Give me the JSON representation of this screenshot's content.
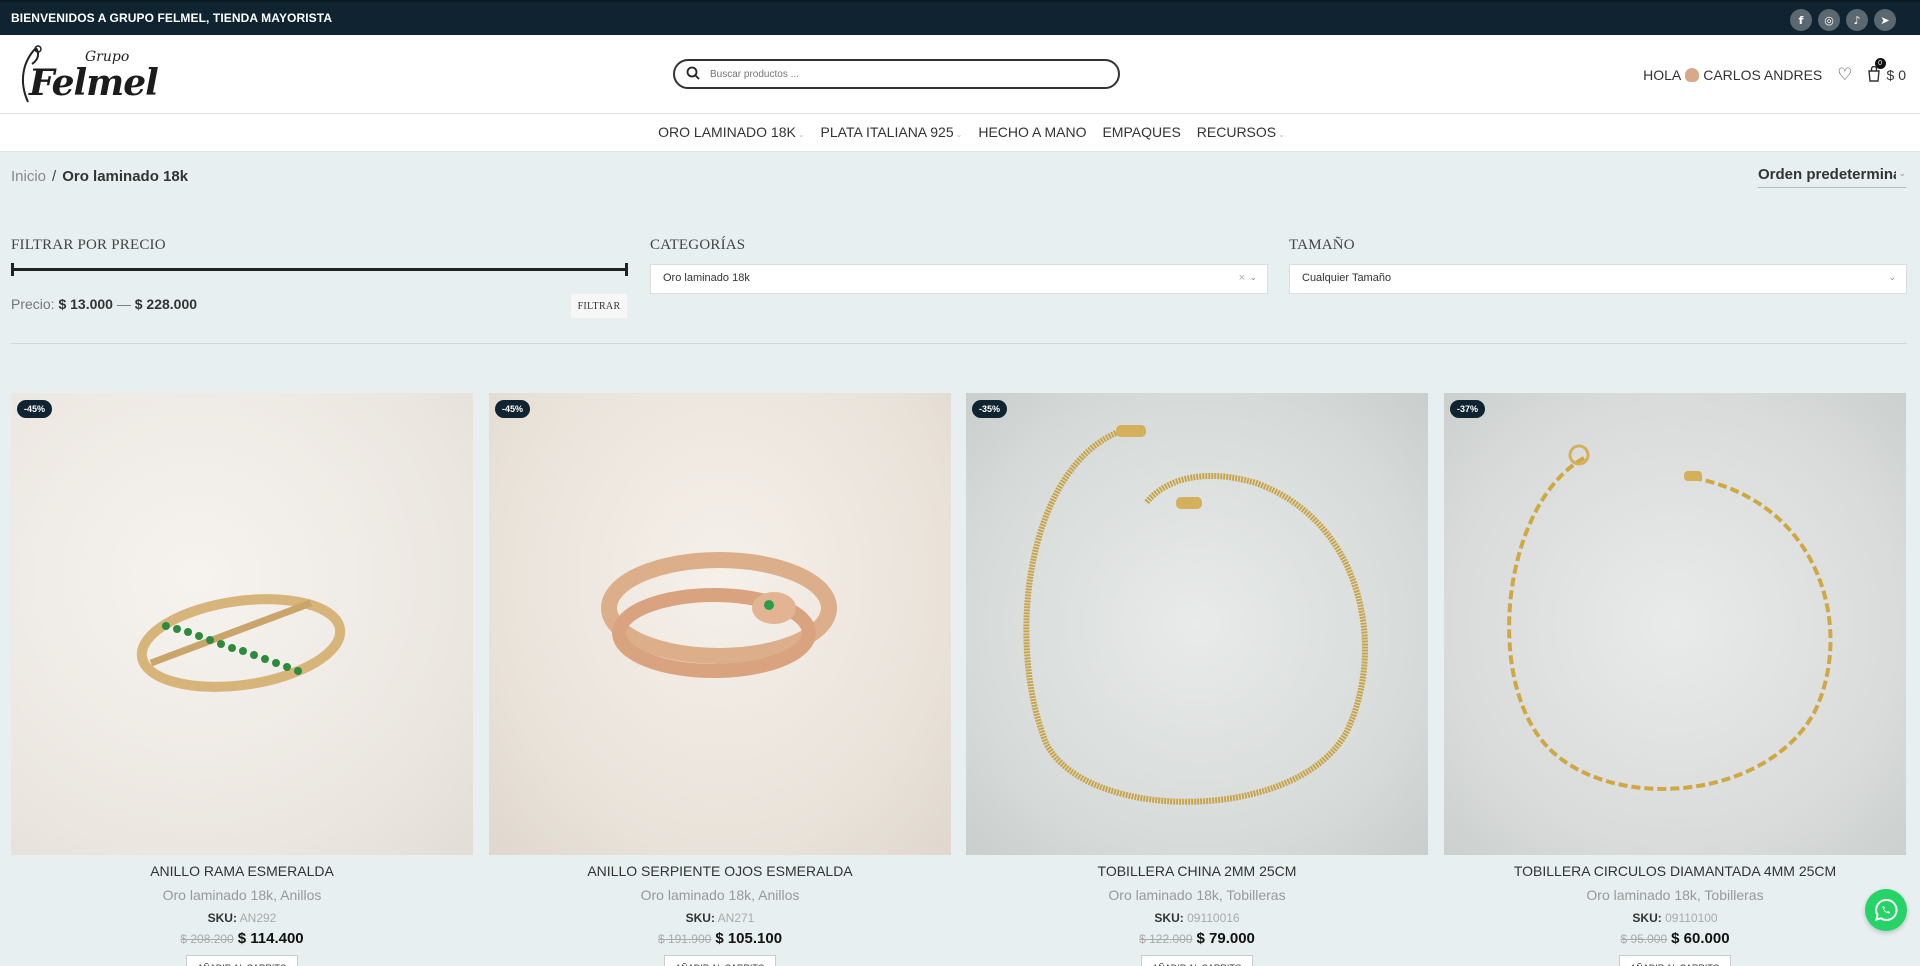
{
  "topbar": {
    "message": "BIENVENIDOS A GRUPO FELMEL, TIENDA MAYORISTA",
    "social": [
      {
        "icon": "facebook-icon",
        "glyph": "f"
      },
      {
        "icon": "instagram-icon",
        "glyph": "◎"
      },
      {
        "icon": "tiktok-icon",
        "glyph": "♪"
      },
      {
        "icon": "telegram-icon",
        "glyph": "➤"
      }
    ]
  },
  "header": {
    "logo": {
      "small": "Grupo",
      "big": "Felmel"
    },
    "search_placeholder": "Buscar productos ...",
    "greeting": "HOLA",
    "user_name": "CARLOS ANDRES",
    "cart_count": "0",
    "cart_total": "$ 0"
  },
  "nav": [
    {
      "label": "ORO LAMINADO 18K",
      "has_dropdown": true
    },
    {
      "label": "PLATA ITALIANA 925",
      "has_dropdown": true
    },
    {
      "label": "HECHO A MANO",
      "has_dropdown": false
    },
    {
      "label": "EMPAQUES",
      "has_dropdown": false
    },
    {
      "label": "RECURSOS",
      "has_dropdown": true
    }
  ],
  "breadcrumb": {
    "home": "Inicio",
    "separator": "/",
    "current": "Oro laminado 18k"
  },
  "ordering": {
    "selected": "Orden predeterminado"
  },
  "filters": {
    "price": {
      "title": "FILTRAR POR PRECIO",
      "label": "Precio:",
      "min": "$ 13.000",
      "dash": "—",
      "max": "$ 228.000",
      "button": "FILTRAR"
    },
    "categories": {
      "title": "CATEGORÍAS",
      "selected": "Oro laminado 18k",
      "clear": "×"
    },
    "size": {
      "title": "TAMAÑO",
      "selected": "Cualquier Tamaño"
    }
  },
  "products": [
    {
      "badge": "-45%",
      "title": "ANILLO RAMA ESMERALDA",
      "categories": "Oro laminado 18k, Anillos",
      "sku_label": "SKU:",
      "sku": "AN292",
      "old_price": "$ 208.200",
      "price": "$ 114.400",
      "button": "AÑADIR AL CARRITO",
      "image": "ring-branch-emerald"
    },
    {
      "badge": "-45%",
      "title": "ANILLO SERPIENTE OJOS ESMERALDA",
      "categories": "Oro laminado 18k, Anillos",
      "sku_label": "SKU:",
      "sku": "AN271",
      "old_price": "$ 191.900",
      "price": "$ 105.100",
      "button": "AÑADIR AL CARRITO",
      "image": "ring-snake"
    },
    {
      "badge": "-35%",
      "title": "TOBILLERA CHINA 2MM 25CM",
      "categories": "Oro laminado 18k, Tobilleras",
      "sku_label": "SKU:",
      "sku": "09110016",
      "old_price": "$ 122.000",
      "price": "$ 79.000",
      "button": "AÑADIR AL CARRITO",
      "image": "anklet-thin"
    },
    {
      "badge": "-37%",
      "title": "TOBILLERA CIRCULOS DIAMANTADA 4MM 25CM",
      "categories": "Oro laminado 18k, Tobilleras",
      "sku_label": "SKU:",
      "sku": "09110100",
      "old_price": "$ 95.000",
      "price": "$ 60.000",
      "button": "AÑADIR AL CARRITO",
      "image": "anklet-circles"
    }
  ],
  "whatsapp": {
    "icon": "whatsapp-icon"
  }
}
